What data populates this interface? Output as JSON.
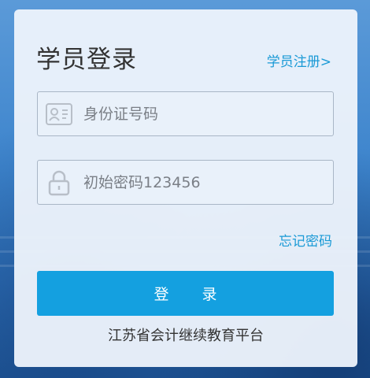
{
  "login": {
    "title": "学员登录",
    "register_link": "学员注册>",
    "id_field": {
      "placeholder": "身份证号码",
      "icon": "id-card-icon"
    },
    "password_field": {
      "placeholder": "初始密码123456",
      "icon": "lock-icon"
    },
    "forgot_link": "忘记密码",
    "login_button": "登 录",
    "footer_text": "江苏省会计继续教育平台"
  },
  "colors": {
    "accent": "#14a0e0",
    "link": "#1a9ad6",
    "card_bg": "#ecf3fb",
    "page_bg": "#3d84cc"
  }
}
